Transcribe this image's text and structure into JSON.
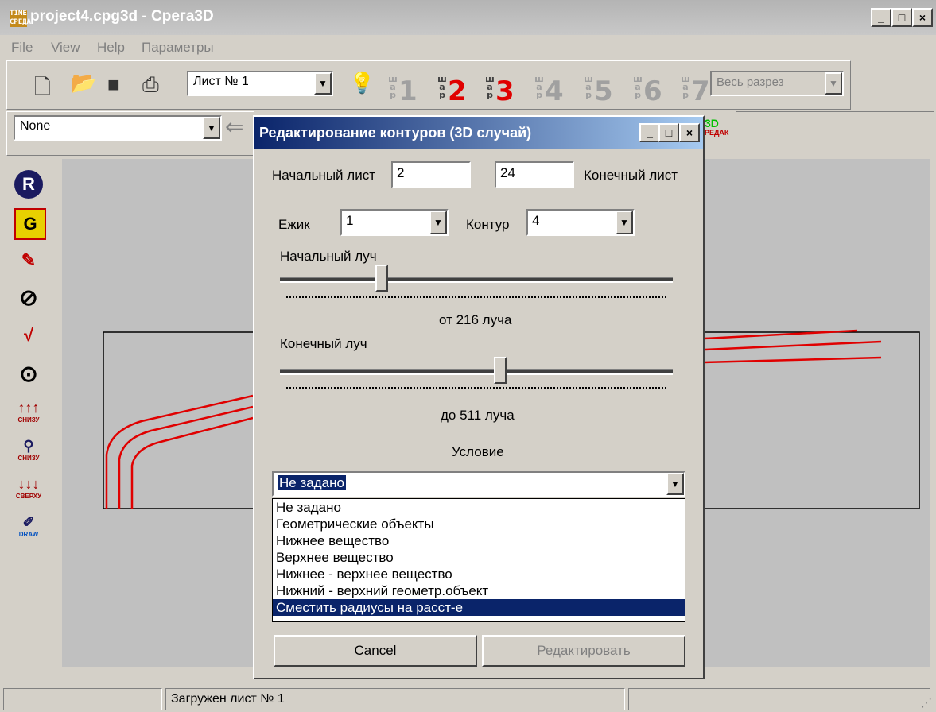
{
  "window": {
    "logo": "TIME СРЕДА",
    "title": "project4.cpg3d - Срeга3D",
    "min": "_",
    "max": "□",
    "close": "×"
  },
  "menu": [
    "File",
    "View",
    "Help",
    "Параметры"
  ],
  "toolbar": {
    "sheet_select": "Лист № 1",
    "layers": [
      "1",
      "2",
      "3",
      "4",
      "5",
      "6",
      "7"
    ],
    "layer_tiny": "ш а р",
    "section_select": "Весь разрез"
  },
  "toolbar2": {
    "object_select": "None",
    "mode_3d": "3D",
    "mode_redak": "РЕДАК"
  },
  "left_tools": {
    "r_label": "R",
    "g_label": "G",
    "snizu": "СНИЗУ",
    "sverhu": "СВЕРХУ",
    "draw": "DRAW"
  },
  "dialog": {
    "title": "Редактирование контуров (3D случай)",
    "start_sheet_label": "Начальный лист",
    "start_sheet_value": "2",
    "end_sheet_value": "24",
    "end_sheet_label": "Конечный лист",
    "ezhik_label": "Ежик",
    "ezhik_value": "1",
    "kontur_label": "Контур",
    "kontur_value": "4",
    "start_ray_label": "Начальный луч",
    "start_ray_value_text": "от 216 луча",
    "end_ray_label": "Конечный луч",
    "end_ray_value_text": "до 511 луча",
    "start_ray_position": 0.26,
    "end_ray_position": 0.56,
    "condition_label": "Условие",
    "condition_value": "Не задано",
    "condition_options": [
      "Не задано",
      "Геометрические объекты",
      "Нижнее вещество",
      "Верхнее вещество",
      "Нижнее - верхнее вещество",
      "Нижний - верхний геометр.объект",
      "Сместить радиусы на расст-е"
    ],
    "highlighted_option_index": 6,
    "cancel_label": "Cancel",
    "edit_label": "Редактировать"
  },
  "status": {
    "message": "Загружен лист № 1"
  },
  "colors": {
    "contour": "#e00000",
    "selection": "#0a246a"
  }
}
